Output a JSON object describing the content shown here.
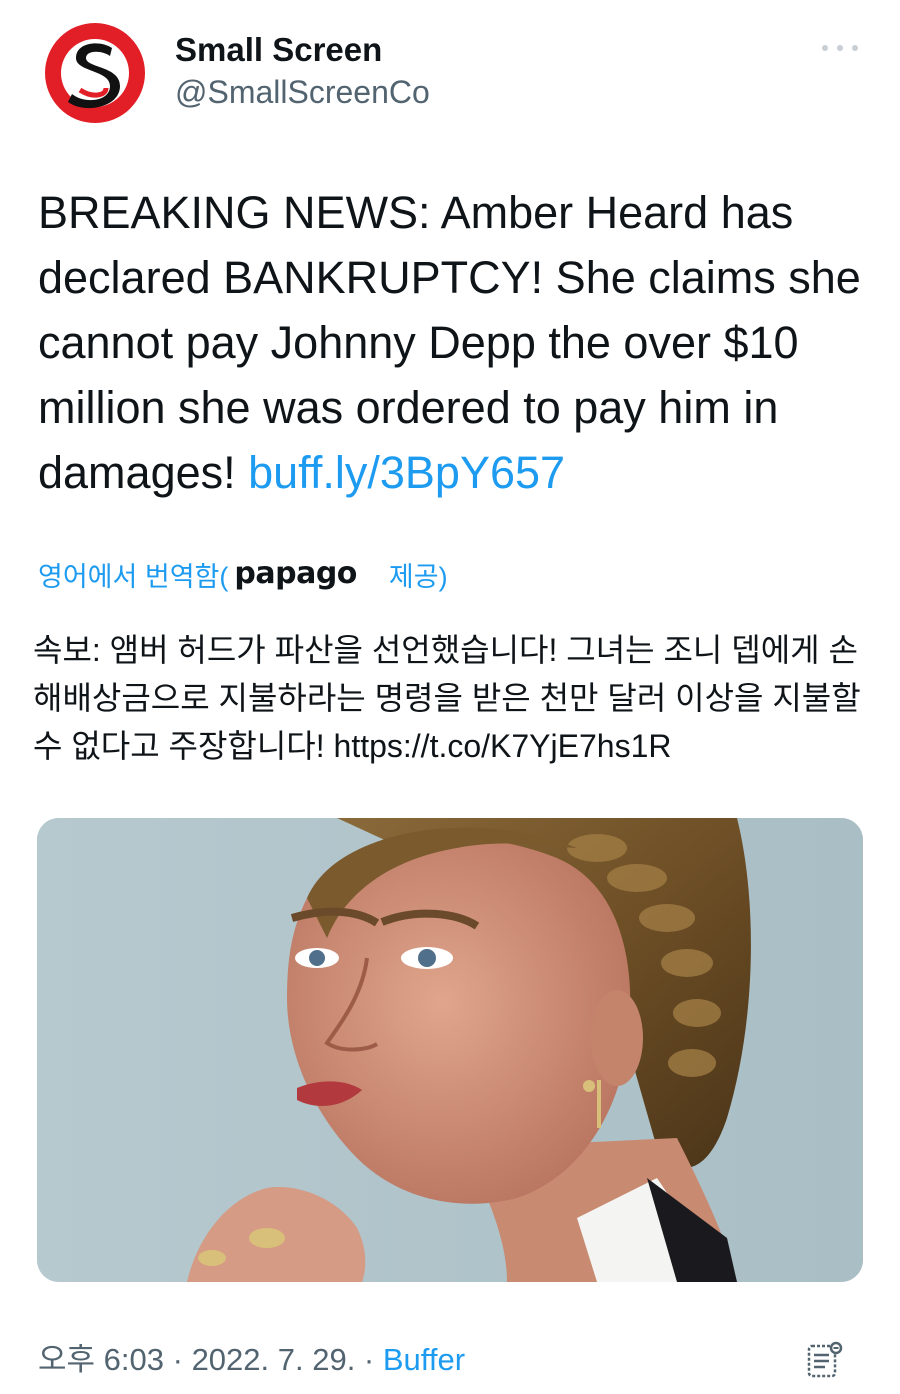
{
  "author": {
    "display_name": "Small Screen",
    "handle": "@SmallScreenCo",
    "avatar_icon": "small-screen-s-logo-icon",
    "avatar_colors": {
      "ring": "#e21f26",
      "letter": "#111111",
      "bg": "#ffffff"
    }
  },
  "more_icon": "more-horizontal-icon",
  "tweet": {
    "text": "BREAKING NEWS: Amber Heard has declared BANKRUPTCY! She claims she cannot pay Johnny Depp the over $10 million she was ordered to pay him in damages!",
    "link_text": "buff.ly/3BpY657"
  },
  "translation": {
    "prefix": "영어에서 번역함(",
    "provider": "papago",
    "suffix": "제공)",
    "text": "속보: 앰버 허드가 파산을 선언했습니다! 그녀는 조니 뎁에게 손해배상금으로 지불하라는 명령을 받은 천만 달러 이상을 지불할 수 없다고 주장합니다! https://t.co/K7YjE7hs1R"
  },
  "media": {
    "type": "photo",
    "subject": "woman-portrait-photo"
  },
  "footer": {
    "time": "오후 6:03",
    "sep1": " · ",
    "date": "2022. 7. 29.",
    "sep2": " · ",
    "source": "Buffer",
    "icon": "view-analytics-icon"
  },
  "colors": {
    "link": "#1d9bf0",
    "text": "#0f1419",
    "secondary": "#536471",
    "media_bg": "#b3c6cc"
  }
}
